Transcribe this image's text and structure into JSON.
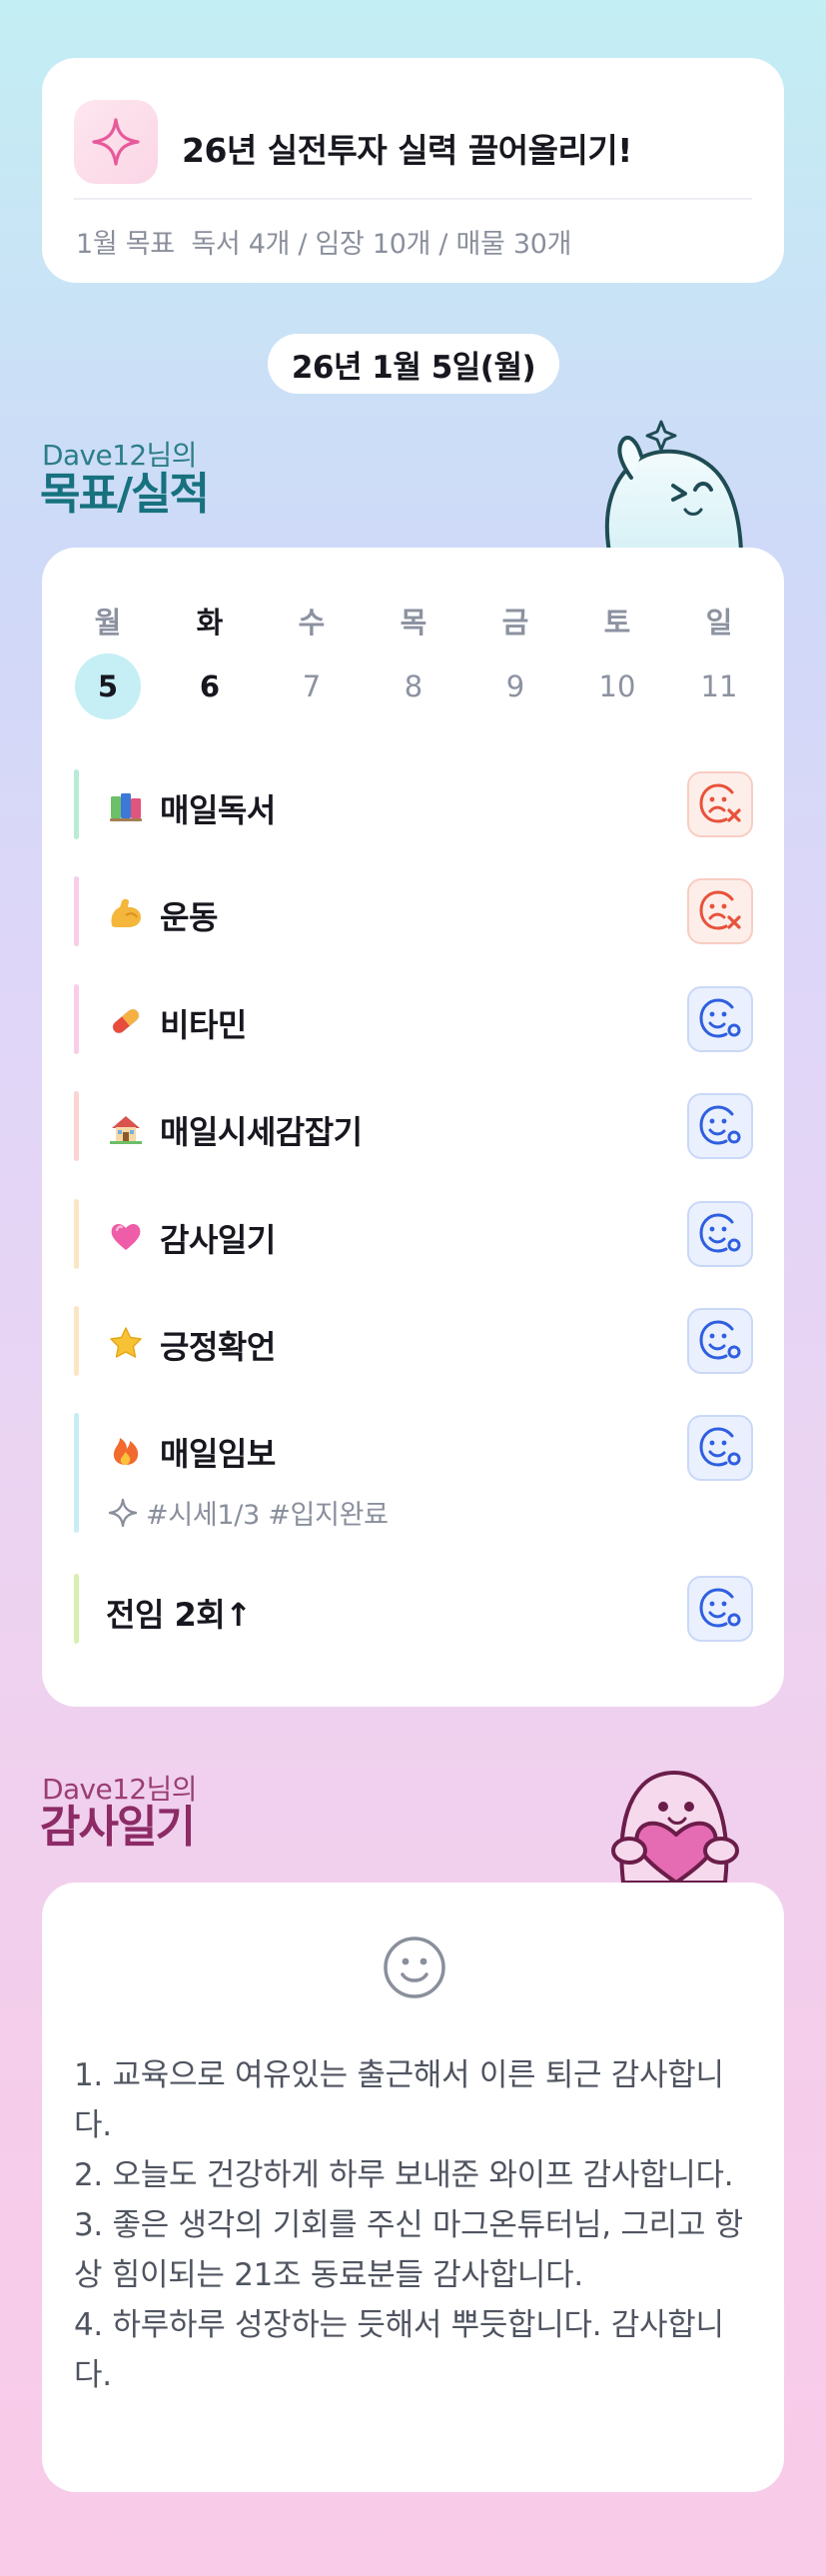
{
  "goal_card": {
    "title": "26년 실전투자 실력 끌어올리기!",
    "subtitle": "1월 목표  독서 4개 / 임장 10개 / 매물 30개",
    "icon": "sparkle-icon"
  },
  "date": "26년 1월 5일(월)",
  "goals_section": {
    "owner": "Dave12님의",
    "title": "목표/실적",
    "mascot": "ghost-mascot"
  },
  "week": {
    "days": [
      {
        "name": "월",
        "num": "5"
      },
      {
        "name": "화",
        "num": "6"
      },
      {
        "name": "수",
        "num": "7"
      },
      {
        "name": "목",
        "num": "8"
      },
      {
        "name": "금",
        "num": "9"
      },
      {
        "name": "토",
        "num": "10"
      },
      {
        "name": "일",
        "num": "11"
      }
    ],
    "selected_index": 0,
    "today_index": 1
  },
  "habits": [
    {
      "label": "매일독서",
      "emoji": "books-icon",
      "bar_color": "#b8ecd6",
      "status": "fail"
    },
    {
      "label": "운동",
      "emoji": "flexed-bicep-icon",
      "bar_color": "#f9cde7",
      "status": "fail"
    },
    {
      "label": "비타민",
      "emoji": "pill-icon",
      "bar_color": "#f9cde7",
      "status": "done"
    },
    {
      "label": "매일시세감잡기",
      "emoji": "house-icon",
      "bar_color": "#fbd4d2",
      "status": "done"
    },
    {
      "label": "감사일기",
      "emoji": "pink-heart-icon",
      "bar_color": "#fbe6c4",
      "status": "done"
    },
    {
      "label": "긍정확언",
      "emoji": "star-icon",
      "bar_color": "#fbe6c4",
      "status": "done"
    },
    {
      "label": "매일임보",
      "emoji": "fire-icon",
      "bar_color": "#c7eef5",
      "status": "done",
      "tags": "#시세1/3 #입지완료"
    },
    {
      "label": "전임 2회↑",
      "emoji": "",
      "bar_color": "#d9efae",
      "status": "done"
    }
  ],
  "gratitude_section": {
    "owner": "Dave12님의",
    "title": "감사일기",
    "mascot": "heart-mascot",
    "icon": "smile-icon",
    "entries": [
      "1. 교육으로 여유있는 출근해서 이른 퇴근 감사합니다.",
      "2. 오늘도 건강하게 하루 보내준 와이프 감사합니다.",
      "3. 좋은 생각의 기회를 주신 마그온튜터님, 그리고 항상 힘이되는 21조 동료분들 감사합니다.",
      "4. 하루하루 성장하는 듯해서 뿌듯합니다. 감사합니다."
    ]
  },
  "colors": {
    "accent_teal": "#17717e",
    "accent_plum": "#8c2b66",
    "fail_red": "#e8523a",
    "ok_blue": "#2f5fe0"
  }
}
